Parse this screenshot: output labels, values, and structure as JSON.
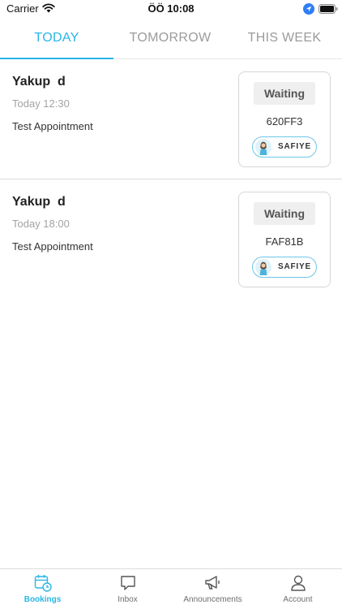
{
  "status_bar": {
    "carrier": "Carrier",
    "time": "ÖÖ 10:08"
  },
  "tabs": [
    {
      "label": "TODAY",
      "active": true
    },
    {
      "label": "TOMORROW",
      "active": false
    },
    {
      "label": "THIS WEEK",
      "active": false
    }
  ],
  "bookings": [
    {
      "customer": "Yakup  d",
      "time": "Today 12:30",
      "service": "Test Appointment",
      "status": "Waiting",
      "code": "620FF3",
      "staff": "SAFIYE"
    },
    {
      "customer": "Yakup  d",
      "time": "Today 18:00",
      "service": "Test Appointment",
      "status": "Waiting",
      "code": "FAF81B",
      "staff": "SAFIYE"
    }
  ],
  "tab_bar": [
    {
      "label": "Bookings",
      "icon": "calendar-clock-icon",
      "active": true
    },
    {
      "label": "Inbox",
      "icon": "chat-bubble-icon",
      "active": false
    },
    {
      "label": "Announcements",
      "icon": "megaphone-icon",
      "active": false
    },
    {
      "label": "Account",
      "icon": "person-icon",
      "active": false
    }
  ],
  "colors": {
    "accent": "#29b6e6",
    "inactive_tab": "#9b9b9b",
    "chip_border": "#6fc6e7"
  }
}
